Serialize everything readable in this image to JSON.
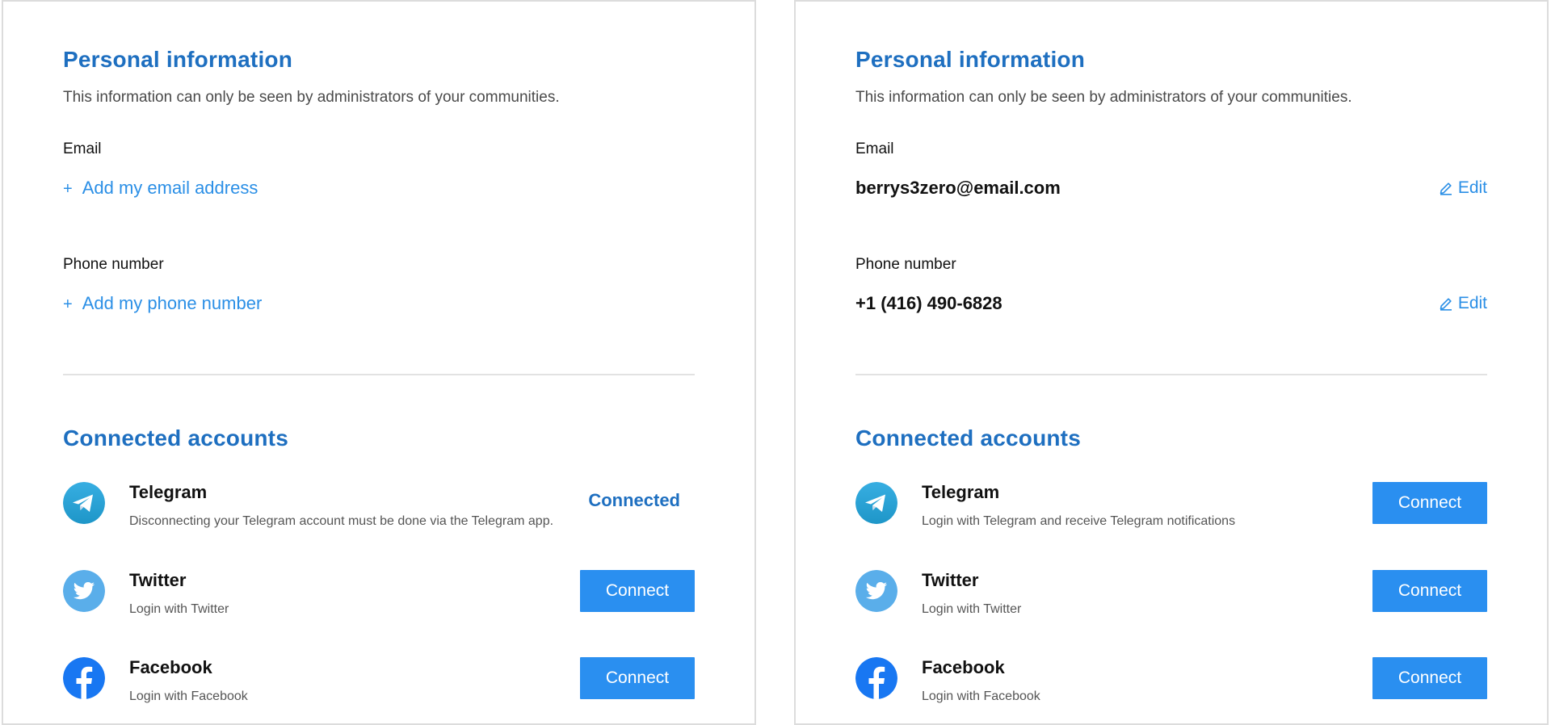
{
  "colors": {
    "heading": "#1e6fc0",
    "link": "#2b8fe6",
    "button": "#2a8ff0"
  },
  "left": {
    "personal_title": "Personal information",
    "personal_desc": "This information can only be seen by administrators of your communities.",
    "email_label": "Email",
    "email_add": "Add my email address",
    "phone_label": "Phone number",
    "phone_add": "Add my phone number",
    "add_symbol": "+",
    "connected_title": "Connected accounts",
    "telegram": {
      "name": "Telegram",
      "sub": "Disconnecting your Telegram account must be done via the Telegram app.",
      "status": "Connected"
    },
    "twitter": {
      "name": "Twitter",
      "sub": "Login with Twitter",
      "button": "Connect"
    },
    "facebook": {
      "name": "Facebook",
      "sub": "Login with Facebook",
      "button": "Connect"
    }
  },
  "right": {
    "personal_title": "Personal information",
    "personal_desc": "This information can only be seen by administrators of your communities.",
    "email_label": "Email",
    "email_value": "berrys3zero@email.com",
    "phone_label": "Phone number",
    "phone_value": "+1 (416) 490-6828",
    "edit_label": "Edit",
    "connected_title": "Connected accounts",
    "telegram": {
      "name": "Telegram",
      "sub": "Login with Telegram and receive Telegram notifications",
      "button": "Connect"
    },
    "twitter": {
      "name": "Twitter",
      "sub": "Login with Twitter",
      "button": "Connect"
    },
    "facebook": {
      "name": "Facebook",
      "sub": "Login with Facebook",
      "button": "Connect"
    }
  }
}
